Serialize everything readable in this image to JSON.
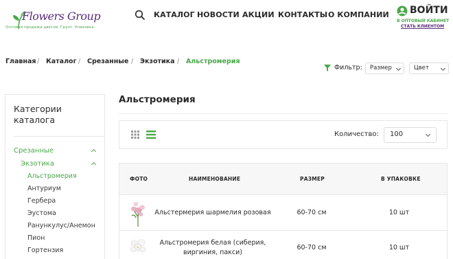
{
  "header": {
    "logo_text": "Flowers Group",
    "logo_tagline": "Оптовая продажа цветов. Грунт. Упаковка.",
    "nav": [
      "КАТАЛОГ",
      "НОВОСТИ",
      "АКЦИИ",
      "КОНТАКТЫ",
      "О КОМПАНИИ"
    ],
    "login_label": "ВОЙТИ",
    "login_sub1": "В ОПТОВЫЙ КАБИНЕТ",
    "login_sub2": "СТАТЬ КЛИЕНТОМ"
  },
  "breadcrumb": [
    "Главная",
    "Каталог",
    "Срезанные",
    "Экзотика",
    "Альстромерия"
  ],
  "breadcrumb_sep": "/",
  "filter": {
    "label": "Фильтр:",
    "size": "Размер",
    "color": "Цвет"
  },
  "sidebar": {
    "title": "Категории каталога",
    "level1": "Срезанные",
    "level2": "Экзотика",
    "items": [
      "Альстромерия",
      "Антуриум",
      "Гербера",
      "Эустома",
      "Ранункулус/Анемон",
      "Пион",
      "Гортензия"
    ]
  },
  "main": {
    "title": "Альстромерия",
    "qty_label": "Количество:",
    "qty_value": "100"
  },
  "table": {
    "headers": [
      "ФОТО",
      "НАИМЕНОВАНИЕ",
      "РАЗМЕР",
      "В УПАКОВКЕ"
    ],
    "rows": [
      {
        "name": "Альстермерия шармелия розовая",
        "size": "60-70 см",
        "pack": "10 шт"
      },
      {
        "name": "Альстромерия белая (сиберия, виргиния, пакси)",
        "size": "60-70 см",
        "pack": "10 шт"
      }
    ]
  },
  "colors": {
    "accent_green": "#4aa84a",
    "brand_purple": "#5b2d7a",
    "text": "#2a2a2a"
  },
  "icons": [
    "leaf-logo-icon",
    "search-icon",
    "user-icon",
    "filter-icon",
    "grid-view-icon",
    "list-view-icon",
    "chevron-up-icon",
    "chevron-down-icon"
  ]
}
